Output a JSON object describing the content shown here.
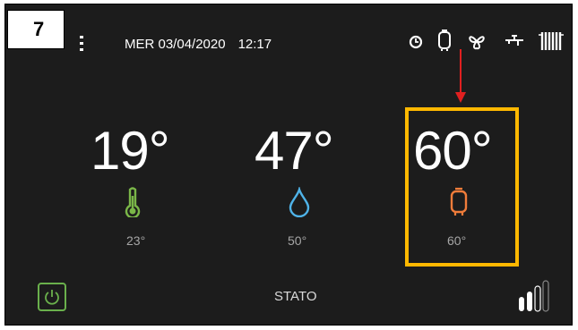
{
  "step": {
    "number": "7"
  },
  "header": {
    "date": "MER 03/04/2020",
    "time": "12:17",
    "status_icons": [
      "clock-icon",
      "boiler-tank-icon",
      "fan-icon",
      "faucet-icon",
      "radiator-icon"
    ]
  },
  "zones": [
    {
      "name": "room",
      "current": "19°",
      "icon": "thermometer-icon",
      "icon_color": "#7ab648",
      "setpoint": "23°"
    },
    {
      "name": "humidity",
      "current": "47°",
      "icon": "water-drop-icon",
      "icon_color": "#4fb3e8",
      "setpoint": "50°"
    },
    {
      "name": "hot-water",
      "current": "60°",
      "icon": "boiler-tank-icon",
      "icon_color": "#f07c3a",
      "setpoint": "60°"
    }
  ],
  "footer": {
    "status_label": "STATO",
    "power_icon": "power-icon",
    "signal_icon": "signal-strength-icon",
    "signal_bars_filled": 2,
    "signal_bars_total": 4
  },
  "colors": {
    "highlight": "#ffb800",
    "annotation_arrow": "#e02020",
    "background": "#1c1c1c"
  }
}
